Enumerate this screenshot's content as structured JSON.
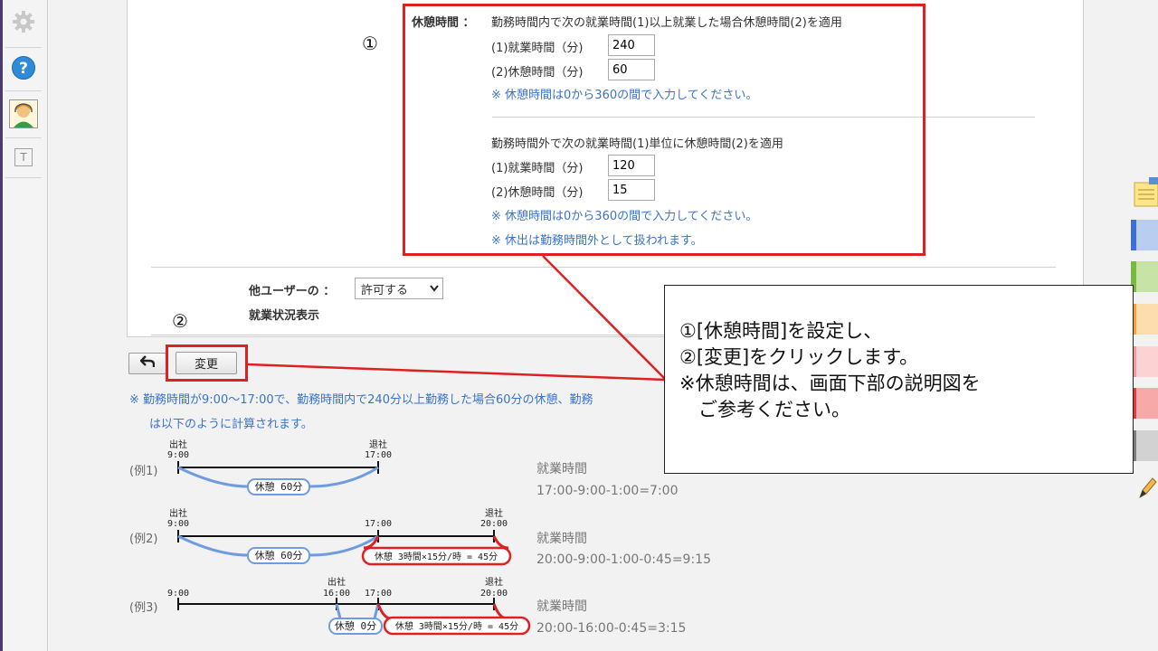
{
  "sidebar": {
    "icons": [
      "gear-icon",
      "help-icon",
      "support-avatar-icon",
      "text-tool-icon"
    ],
    "text_icon_glyph": "T"
  },
  "break_settings": {
    "marker": "①",
    "label": "休憩時間 ：",
    "inside": {
      "heading": "勤務時間内で次の就業時間(1)以上就業した場合休憩時間(2)を適用",
      "work_label": "(1)就業時間（分)",
      "work_value": "240",
      "break_label": "(2)休憩時間（分)",
      "break_value": "60",
      "note": "※ 休憩時間は0から360の間で入力してください。"
    },
    "outside": {
      "heading": "勤務時間外で次の就業時間(1)単位に休憩時間(2)を適用",
      "work_label": "(1)就業時間（分)",
      "work_value": "120",
      "break_label": "(2)休憩時間（分)",
      "break_value": "15",
      "note1": "※ 休憩時間は0から360の間で入力してください。",
      "note2": "※ 休出は勤務時間外として扱われます。"
    }
  },
  "other_user": {
    "label_line1": "他ユーザーの ：",
    "label_line2": "就業状況表示",
    "select_value": "許可する"
  },
  "actions": {
    "marker": "②",
    "back_glyph": "↶",
    "change_label": "変更"
  },
  "footnote": {
    "line1": "※ 勤務時間が9:00～17:00で、勤務時間内で240分以上勤務した場合60分の休憩、勤務",
    "line2": "は以下のように計算されます。"
  },
  "examples": [
    {
      "label": "(例1)",
      "ticks": [
        {
          "top": "出社",
          "time": "9:00"
        },
        {
          "top": "退社",
          "time": "17:00"
        }
      ],
      "break_pill": "休憩 60分",
      "result_title": "就業時間",
      "result_formula": "17:00-9:00-1:00=7:00"
    },
    {
      "label": "(例2)",
      "ticks": [
        {
          "top": "出社",
          "time": "9:00"
        },
        {
          "top": "",
          "time": "17:00"
        },
        {
          "top": "退社",
          "time": "20:00"
        }
      ],
      "break_pill": "休憩 60分",
      "overtime_pill": "休憩 3時間×15分/時 = 45分",
      "result_title": "就業時間",
      "result_formula": "20:00-9:00-1:00-0:45=9:15"
    },
    {
      "label": "(例3)",
      "ticks": [
        {
          "top": "",
          "time": "9:00"
        },
        {
          "top": "出社",
          "time": "16:00"
        },
        {
          "top": "",
          "time": "17:00"
        },
        {
          "top": "退社",
          "time": "20:00"
        }
      ],
      "break_pill": "休憩 0分",
      "overtime_pill": "休憩 3時間×15分/時 = 45分",
      "result_title": "就業時間",
      "result_formula": "20:00-16:00-0:45=3:15"
    }
  ],
  "callout": {
    "line1": "①[休憩時間]を設定し、",
    "line2": "②[変更]をクリックします。",
    "line3": "※休憩時間は、画面下部の説明図を",
    "line4": "　ご参考ください。"
  },
  "colors": {
    "highlight": "#e02020",
    "note_blue": "#3b73c9",
    "timeline_blue": "#6f9be0",
    "overtime_red": "#e02020"
  }
}
